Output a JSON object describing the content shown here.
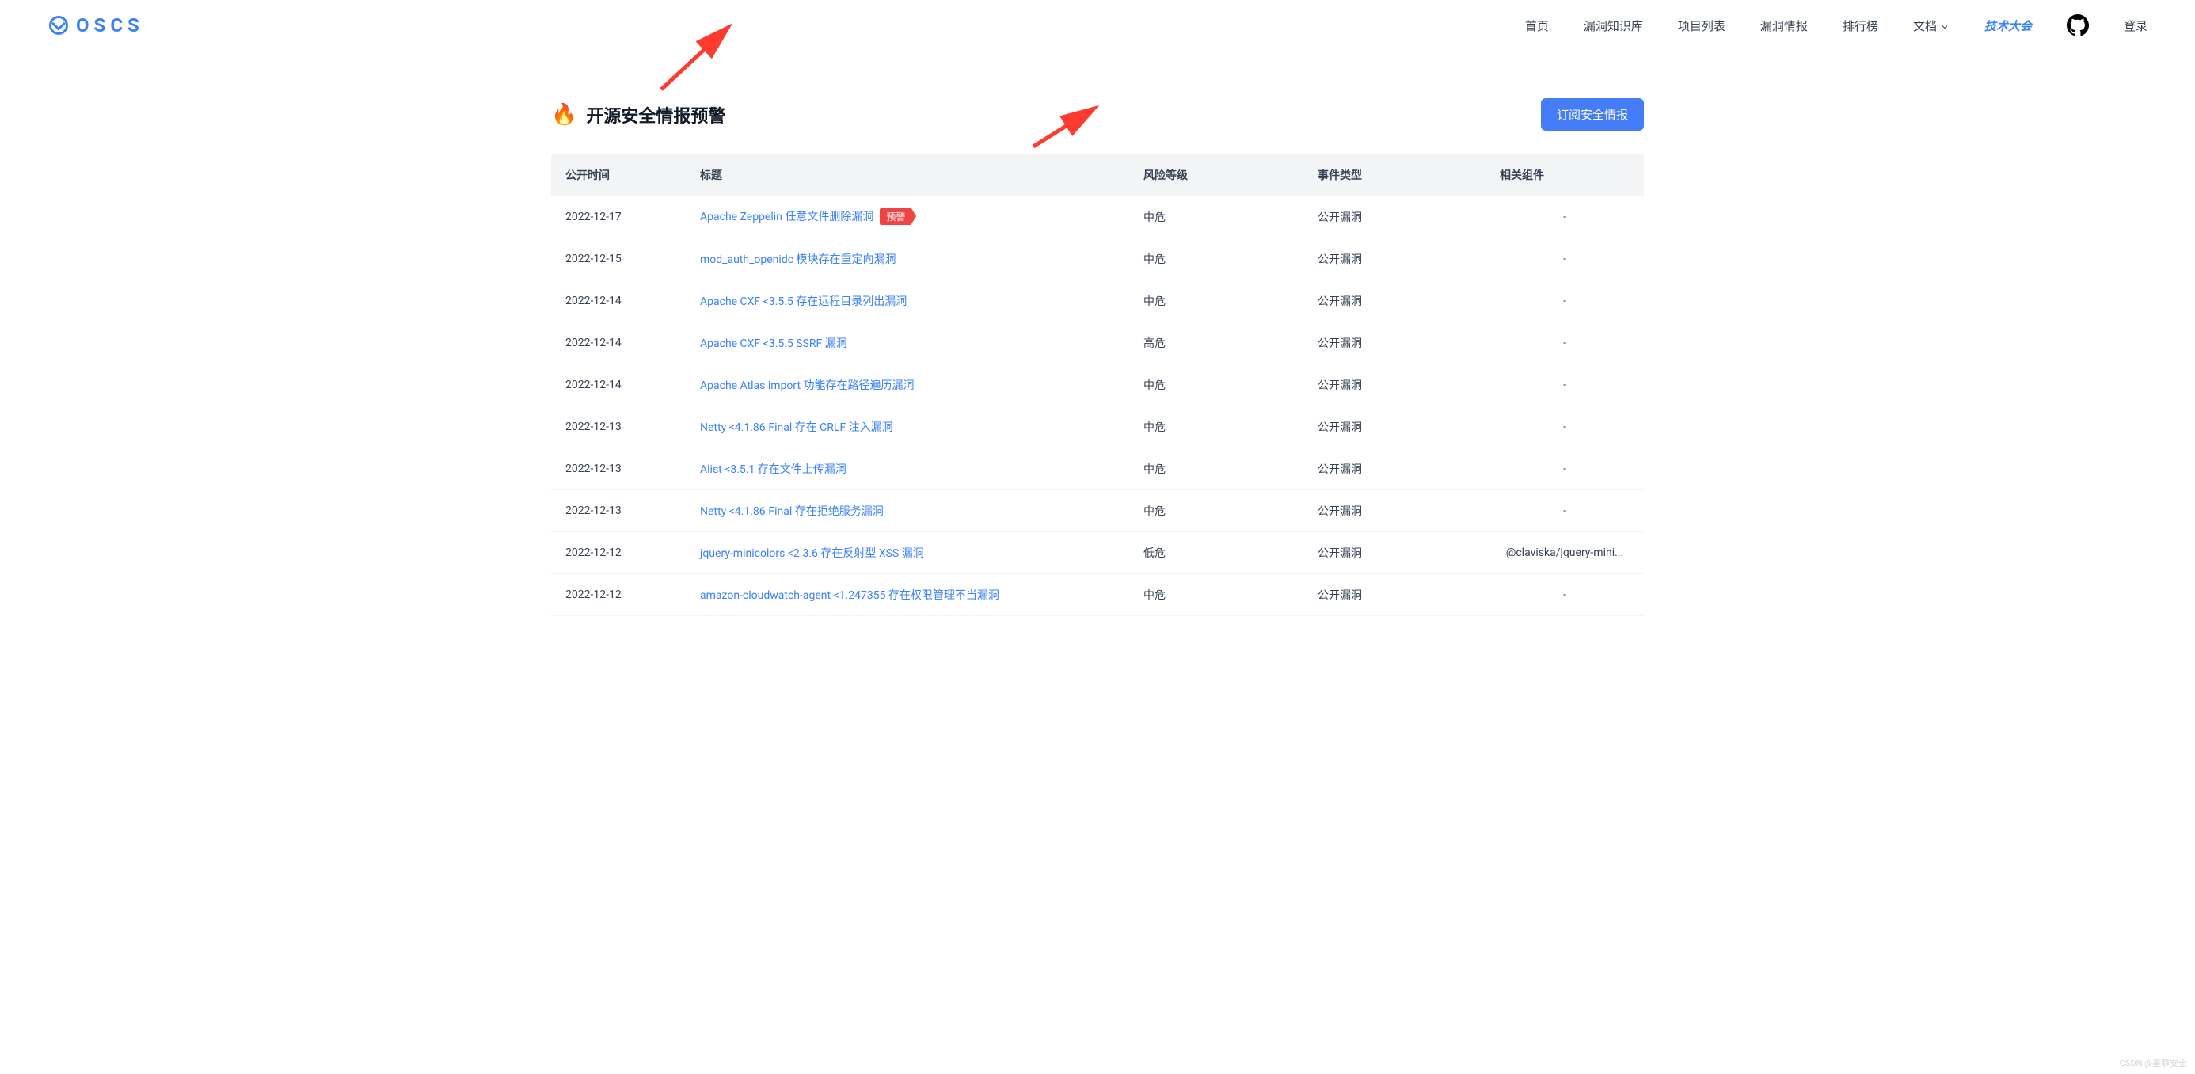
{
  "brand": "OSCS",
  "nav": {
    "home": "首页",
    "knowledge": "漏洞知识库",
    "projects": "项目列表",
    "intel": "漏洞情报",
    "rank": "排行榜",
    "docs": "文档",
    "conf": "技术大会",
    "login": "登录"
  },
  "page": {
    "title": "开源安全情报预警",
    "subscribe": "订阅安全情报"
  },
  "columns": {
    "date": "公开时间",
    "title": "标题",
    "risk": "风险等级",
    "type": "事件类型",
    "component": "相关组件"
  },
  "badge_alert": "预警",
  "risk_labels": {
    "mid": "中危",
    "high": "高危",
    "low": "低危"
  },
  "type_public": "公开漏洞",
  "dash": "-",
  "rows": [
    {
      "date": "2022-12-17",
      "title": "Apache Zeppelin 任意文件删除漏洞",
      "badge": true,
      "risk": "mid",
      "type_key": "public",
      "component": "-"
    },
    {
      "date": "2022-12-15",
      "title": "mod_auth_openidc 模块存在重定向漏洞",
      "risk": "mid",
      "type_key": "public",
      "component": "-"
    },
    {
      "date": "2022-12-14",
      "title": "Apache CXF <3.5.5 存在远程目录列出漏洞",
      "risk": "mid",
      "type_key": "public",
      "component": "-"
    },
    {
      "date": "2022-12-14",
      "title": "Apache CXF <3.5.5 SSRF 漏洞",
      "risk": "high",
      "type_key": "public",
      "component": "-"
    },
    {
      "date": "2022-12-14",
      "title": "Apache Atlas import 功能存在路径遍历漏洞",
      "risk": "mid",
      "type_key": "public",
      "component": "-"
    },
    {
      "date": "2022-12-13",
      "title": "Netty <4.1.86.Final 存在 CRLF 注入漏洞",
      "risk": "mid",
      "type_key": "public",
      "component": "-"
    },
    {
      "date": "2022-12-13",
      "title": "Alist <3.5.1 存在文件上传漏洞",
      "risk": "mid",
      "type_key": "public",
      "component": "-"
    },
    {
      "date": "2022-12-13",
      "title": "Netty <4.1.86.Final 存在拒绝服务漏洞",
      "risk": "mid",
      "type_key": "public",
      "component": "-"
    },
    {
      "date": "2022-12-12",
      "title": "jquery-minicolors <2.3.6 存在反射型 XSS 漏洞",
      "risk": "low",
      "type_key": "public",
      "component": "@claviska/jquery-mini..."
    },
    {
      "date": "2022-12-12",
      "title": "amazon-cloudwatch-agent <1.247355 存在权限管理不当漏洞",
      "risk": "mid",
      "type_key": "public",
      "component": "-"
    }
  ],
  "watermark": "CSDN @墨菲安全"
}
